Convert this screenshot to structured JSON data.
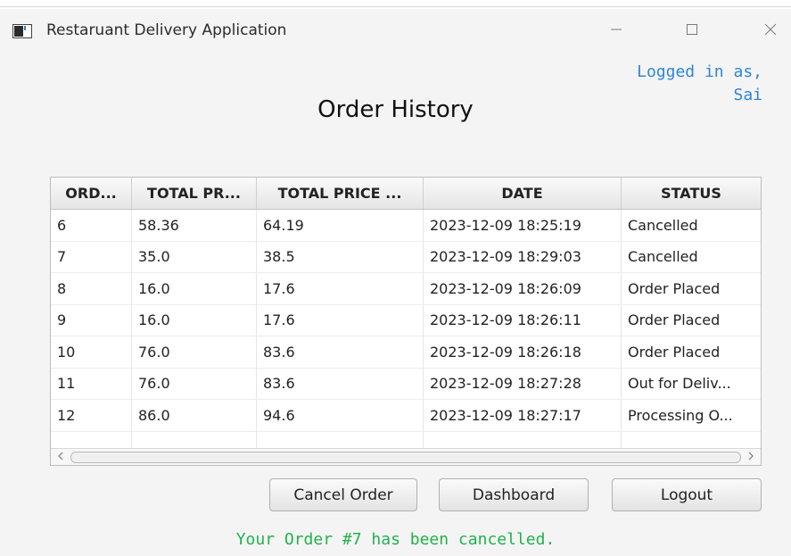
{
  "window": {
    "title": "Restaruant Delivery Application",
    "icons": {
      "app": "window-app-icon",
      "minimize": "minimize-icon",
      "maximize": "maximize-icon",
      "close": "close-icon"
    }
  },
  "login": {
    "line1": "Logged in as,",
    "line2": "Sai"
  },
  "page": {
    "heading": "Order History"
  },
  "table": {
    "columns": [
      "ORD...",
      "TOTAL PR...",
      "TOTAL PRICE ...",
      "DATE",
      "STATUS"
    ],
    "rows": [
      [
        "6",
        "58.36",
        "64.19",
        "2023-12-09 18:25:19",
        "Cancelled"
      ],
      [
        "7",
        "35.0",
        "38.5",
        "2023-12-09 18:29:03",
        "Cancelled"
      ],
      [
        "8",
        "16.0",
        "17.6",
        "2023-12-09 18:26:09",
        "Order Placed"
      ],
      [
        "9",
        "16.0",
        "17.6",
        "2023-12-09 18:26:11",
        "Order Placed"
      ],
      [
        "10",
        "76.0",
        "83.6",
        "2023-12-09 18:26:18",
        "Order Placed"
      ],
      [
        "11",
        "76.0",
        "83.6",
        "2023-12-09 18:27:28",
        "Out for Deliv..."
      ],
      [
        "12",
        "86.0",
        "94.6",
        "2023-12-09 18:27:17",
        "Processing O..."
      ]
    ]
  },
  "buttons": {
    "cancel": "Cancel Order",
    "dashboard": "Dashboard",
    "logout": "Logout"
  },
  "message": "Your Order #7 has been cancelled.",
  "colors": {
    "login_text": "#2d86d6",
    "message_text": "#22b14c",
    "window_bg": "#f4f4f4"
  }
}
